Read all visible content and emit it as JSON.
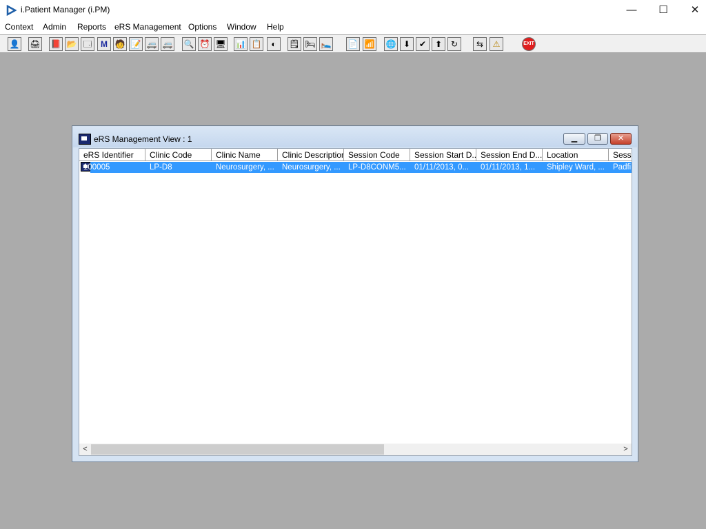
{
  "app": {
    "title": "i.Patient Manager (i.PM)",
    "icon": "play-triangle-icon"
  },
  "window_controls": {
    "minimize": "—",
    "maximize": "☐",
    "close": "✕"
  },
  "menu": [
    "Context",
    "Admin",
    "Reports",
    "eRS Management",
    "Options",
    "Window",
    "Help"
  ],
  "toolbar": {
    "icons": [
      "patient-person-icon",
      "printer-icon",
      "book-icon",
      "folder-edit-icon",
      "screen-list-icon",
      "letter-m-icon",
      "doctor-icon",
      "notepad-icon",
      "vehicle-icon",
      "vehicle-icon",
      "search-document-icon",
      "clock-icon",
      "monitor-icon",
      "chart-board-icon",
      "edit-board-icon",
      "dial-icon",
      "notes-icon",
      "bed-icon",
      "bed-search-icon",
      "page-icon",
      "bar-chart-icon",
      "globe-icon",
      "referral-down-icon",
      "referral-check-icon",
      "referral-green-icon",
      "referral-refresh-icon",
      "transfer-arrows-icon",
      "warning-icon",
      "exit-icon"
    ],
    "glyphs": [
      "👤",
      "🖨",
      "📕",
      "📂",
      "🗔",
      "M",
      "🧑",
      "📝",
      "🚐",
      "🚐",
      "🔍",
      "⏰",
      "🖥",
      "📊",
      "📋",
      "◐",
      "🗒",
      "🛏",
      "🛌",
      "📄",
      "📶",
      "🌐",
      "⬇",
      "✔",
      "⬆",
      "↻",
      "⇆",
      "⚠",
      "EXIT"
    ]
  },
  "child_window": {
    "title": "eRS Management View : 1",
    "buttons": {
      "minimize": "▁",
      "restore": "❐",
      "close": "✕"
    }
  },
  "table": {
    "columns": [
      "eRS Identifier",
      "Clinic Code",
      "Clinic Name",
      "Clinic Description",
      "Session Code",
      "Session Start D...",
      "Session End D...",
      "Location",
      "Sessi"
    ],
    "rows": [
      [
        "100005",
        "LP-D8",
        "Neurosurgery, ...",
        "Neurosurgery, ...",
        "LP-D8CONM5...",
        "01/11/2013, 0...",
        "01/11/2013, 1...",
        "Shipley Ward, ...",
        "Padfi"
      ]
    ]
  },
  "scroll": {
    "left": "<",
    "right": ">"
  },
  "colors": {
    "selection": "#3399ff",
    "desktop": "#ababab",
    "exit": "#e01e1e",
    "warning": "#f3d21a"
  }
}
